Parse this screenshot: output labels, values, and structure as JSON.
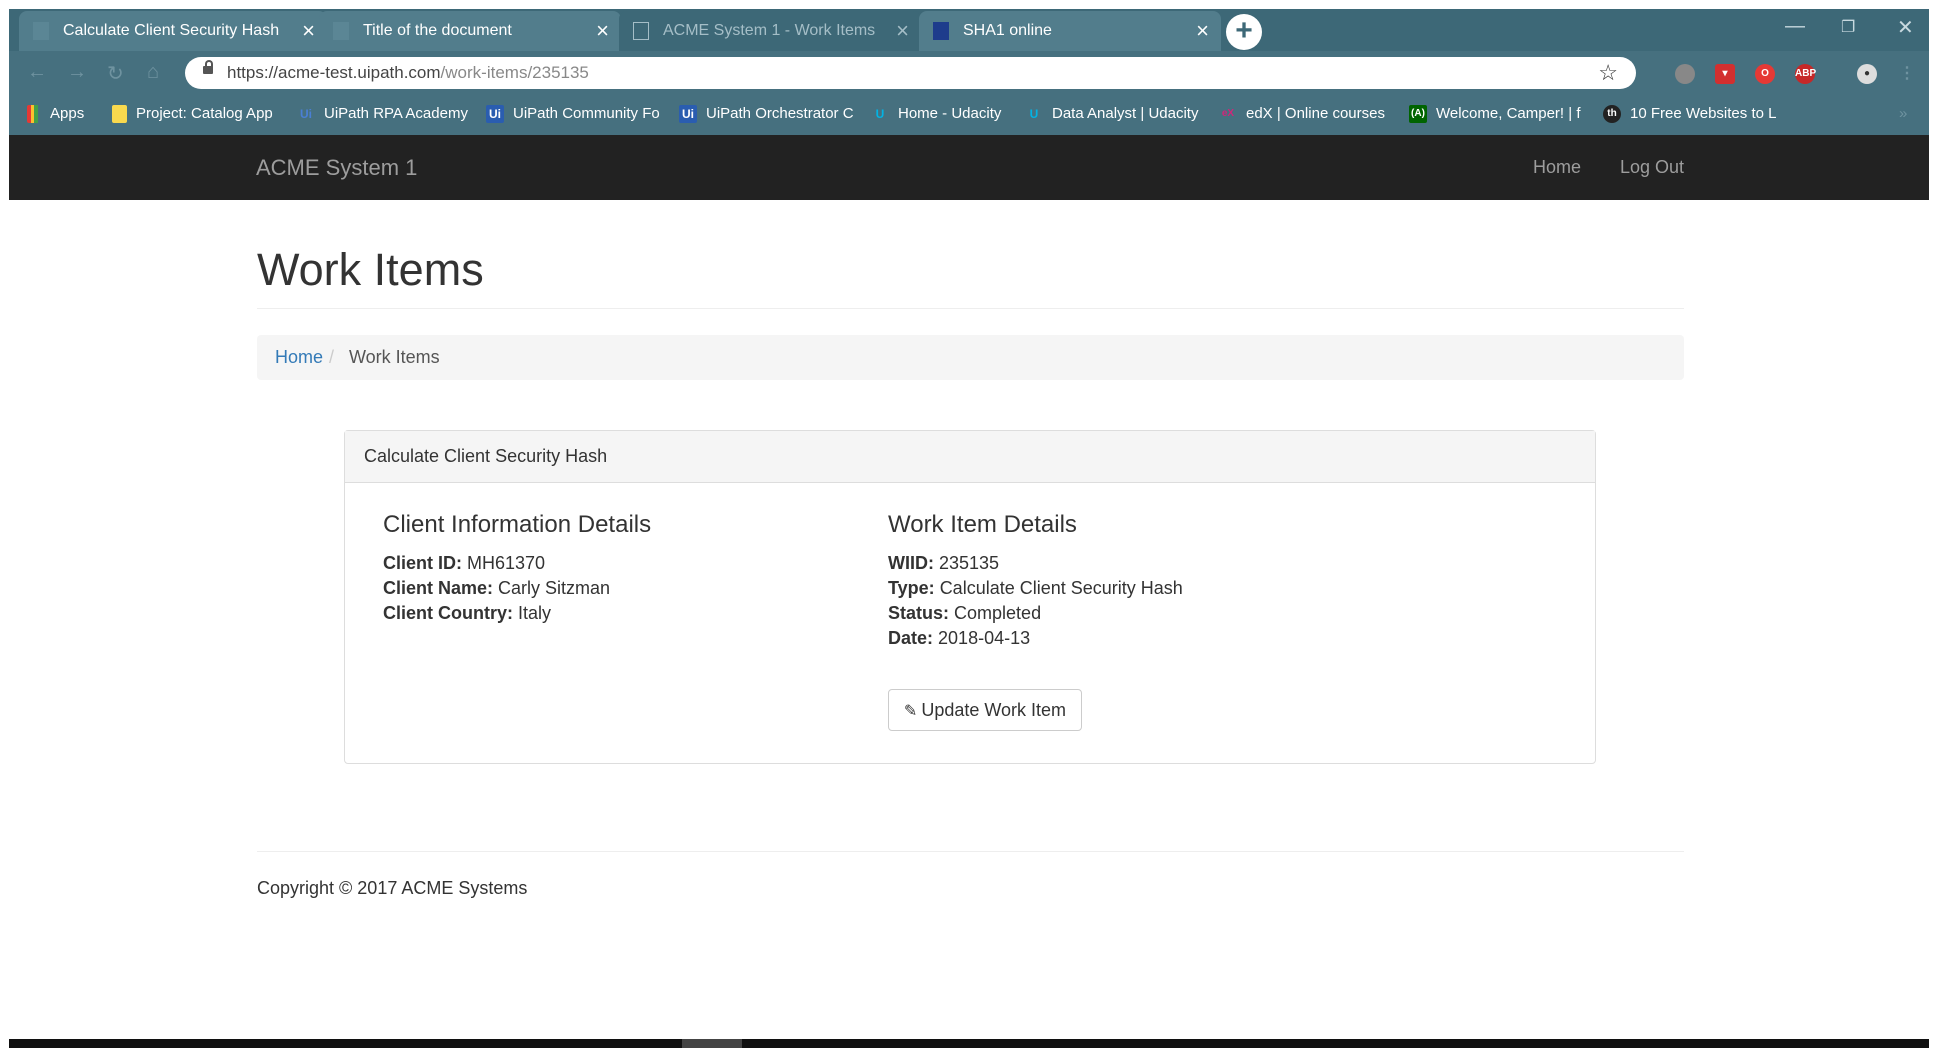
{
  "browser": {
    "tabs": [
      {
        "title": "Calculate Client Security Hash",
        "active": true
      },
      {
        "title": "Title of the document",
        "active": true
      },
      {
        "title": "ACME System 1 - Work Items",
        "active": false
      },
      {
        "title": "SHA1 online",
        "active": true
      }
    ],
    "url_host": "https://acme-test.uipath.com",
    "url_path": "/work-items/235135",
    "bookmarks": [
      {
        "label": "Apps",
        "icon": "apps-grid-icon"
      },
      {
        "label": "Project: Catalog App",
        "icon": "folder-icon"
      },
      {
        "label": "UiPath RPA Academy",
        "icon": "uipath-icon"
      },
      {
        "label": "UiPath Community Fo",
        "icon": "uipath-icon"
      },
      {
        "label": "UiPath Orchestrator C",
        "icon": "uipath-icon"
      },
      {
        "label": "Home - Udacity",
        "icon": "udacity-icon"
      },
      {
        "label": "Data Analyst | Udacity",
        "icon": "udacity-icon"
      },
      {
        "label": "edX | Online courses",
        "icon": "edx-icon"
      },
      {
        "label": "Welcome, Camper! | f",
        "icon": "freecodecamp-icon"
      },
      {
        "label": "10 Free Websites to L",
        "icon": "site-icon"
      }
    ]
  },
  "app": {
    "brand": "ACME System 1",
    "nav": {
      "home": "Home",
      "logout": "Log Out"
    }
  },
  "page": {
    "title": "Work Items",
    "breadcrumb": {
      "home": "Home",
      "separator": "/",
      "current": "Work Items"
    },
    "panel": {
      "heading": "Calculate Client Security Hash",
      "client": {
        "title": "Client Information Details",
        "id_label": "Client ID:",
        "id": "MH61370",
        "name_label": "Client Name:",
        "name": "Carly Sitzman",
        "country_label": "Client Country:",
        "country": "Italy"
      },
      "work_item": {
        "title": "Work Item Details",
        "wiid_label": "WIID:",
        "wiid": "235135",
        "type_label": "Type:",
        "type": "Calculate Client Security Hash",
        "status_label": "Status:",
        "status": "Completed",
        "date_label": "Date:",
        "date": "2018-04-13"
      },
      "update_button": "Update Work Item"
    },
    "footer": "Copyright © 2017 ACME Systems"
  },
  "colors": {
    "navbar": "#222222",
    "link": "#337ab7",
    "chrome": "#46707f"
  }
}
